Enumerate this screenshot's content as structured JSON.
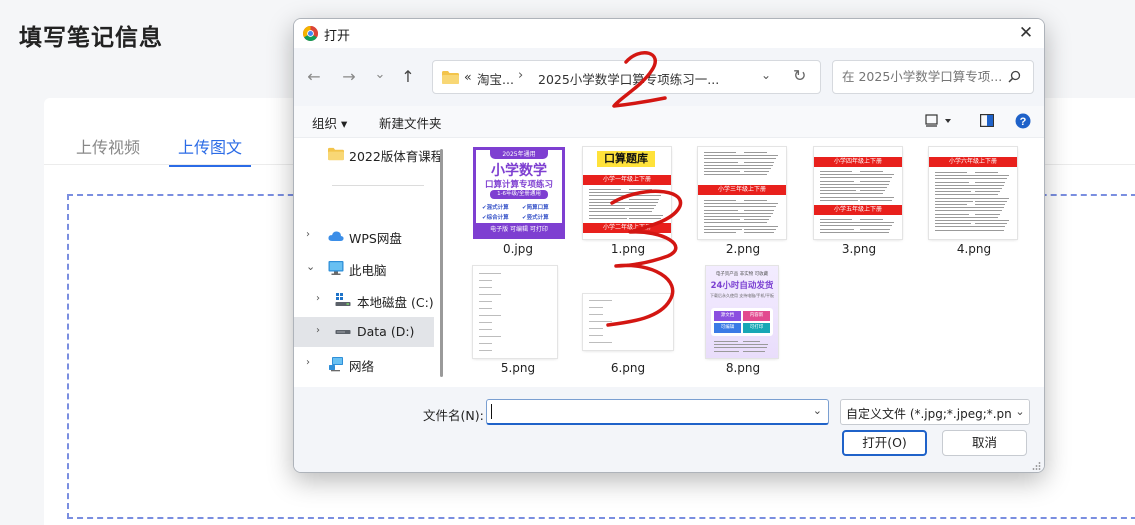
{
  "page": {
    "title": "填写笔记信息",
    "tabs": [
      "上传视频",
      "上传图文"
    ],
    "active_tab_index": 1
  },
  "dialog": {
    "title": "打开",
    "close_glyph": "✕",
    "nav": {
      "back": "←",
      "forward": "→",
      "recent": "⌄",
      "up": "↑"
    },
    "address": {
      "prefix": "«",
      "crumb1": "淘宝...",
      "separator": "›",
      "crumb2": "2025小学数学口算专项练习一...",
      "dropdown_glyph": "⌄",
      "refresh_glyph": "↻"
    },
    "search": {
      "placeholder": "在 2025小学数学口算专项..."
    },
    "toolbar": {
      "organize": "组织 ▾",
      "new_folder": "新建文件夹",
      "help_glyph": "?"
    },
    "sidebar": {
      "items": [
        {
          "label": "2022版体育课程",
          "icon": "folder-icon"
        },
        {
          "label": "WPS网盘",
          "icon": "cloud-icon"
        },
        {
          "label": "此电脑",
          "icon": "pc-icon"
        },
        {
          "label": "本地磁盘 (C:)",
          "icon": "windows-drive-icon"
        },
        {
          "label": "Data (D:)",
          "icon": "drive-icon"
        },
        {
          "label": "网络",
          "icon": "network-icon"
        }
      ],
      "selected_index": 4
    },
    "files": [
      {
        "name": "0.jpg",
        "thumb": {
          "kind": "cover",
          "tag": "2025年通用",
          "line1": "小学数学",
          "line2": "口算计算专项练习",
          "grade": "1-6年级/全册通用",
          "checks": [
            "✔混式计算",
            "✔简算口算",
            "✔综合计算",
            "✔竖式计算"
          ],
          "footer": "电子版 可编辑 可打印"
        }
      },
      {
        "name": "1.png",
        "thumb": {
          "kind": "worksheet",
          "header": "口算题库",
          "bars": [
            "小学一年级上下册",
            "小学二年级上下册"
          ]
        }
      },
      {
        "name": "2.png",
        "thumb": {
          "kind": "worksheet",
          "bars": [
            "小学三年级上下册"
          ]
        }
      },
      {
        "name": "3.png",
        "thumb": {
          "kind": "worksheet",
          "bars": [
            "小学四年级上下册",
            "小学五年级上下册"
          ]
        }
      },
      {
        "name": "4.png",
        "thumb": {
          "kind": "worksheet",
          "bars": [
            "小学六年级上下册"
          ]
        }
      },
      {
        "name": "5.png",
        "thumb": {
          "kind": "exercise"
        }
      },
      {
        "name": "6.png",
        "thumb": {
          "kind": "exercise"
        }
      },
      {
        "name": "8.png",
        "thumb": {
          "kind": "promo",
          "top": "电子资产品 非实物 可收藏",
          "headline": "24小时自动发货",
          "sub": "下载后永久使用 支持电脑/手机/平板",
          "tags": [
            "源文档",
            "内容新",
            "可编辑",
            "可打印"
          ]
        }
      }
    ],
    "bottom": {
      "filename_label": "文件名(N):",
      "filename_value": "",
      "filetype": "自定义文件 (*.jpg;*.jpeg;*.png",
      "open_button": "打开(O)",
      "cancel_button": "取消"
    }
  },
  "colors": {
    "accent": "#2b6be6",
    "dialog_primary": "#1f62c9",
    "thumb_red": "#e8201c",
    "annotation_red": "#d31612"
  },
  "annotations": [
    "2",
    "3"
  ]
}
